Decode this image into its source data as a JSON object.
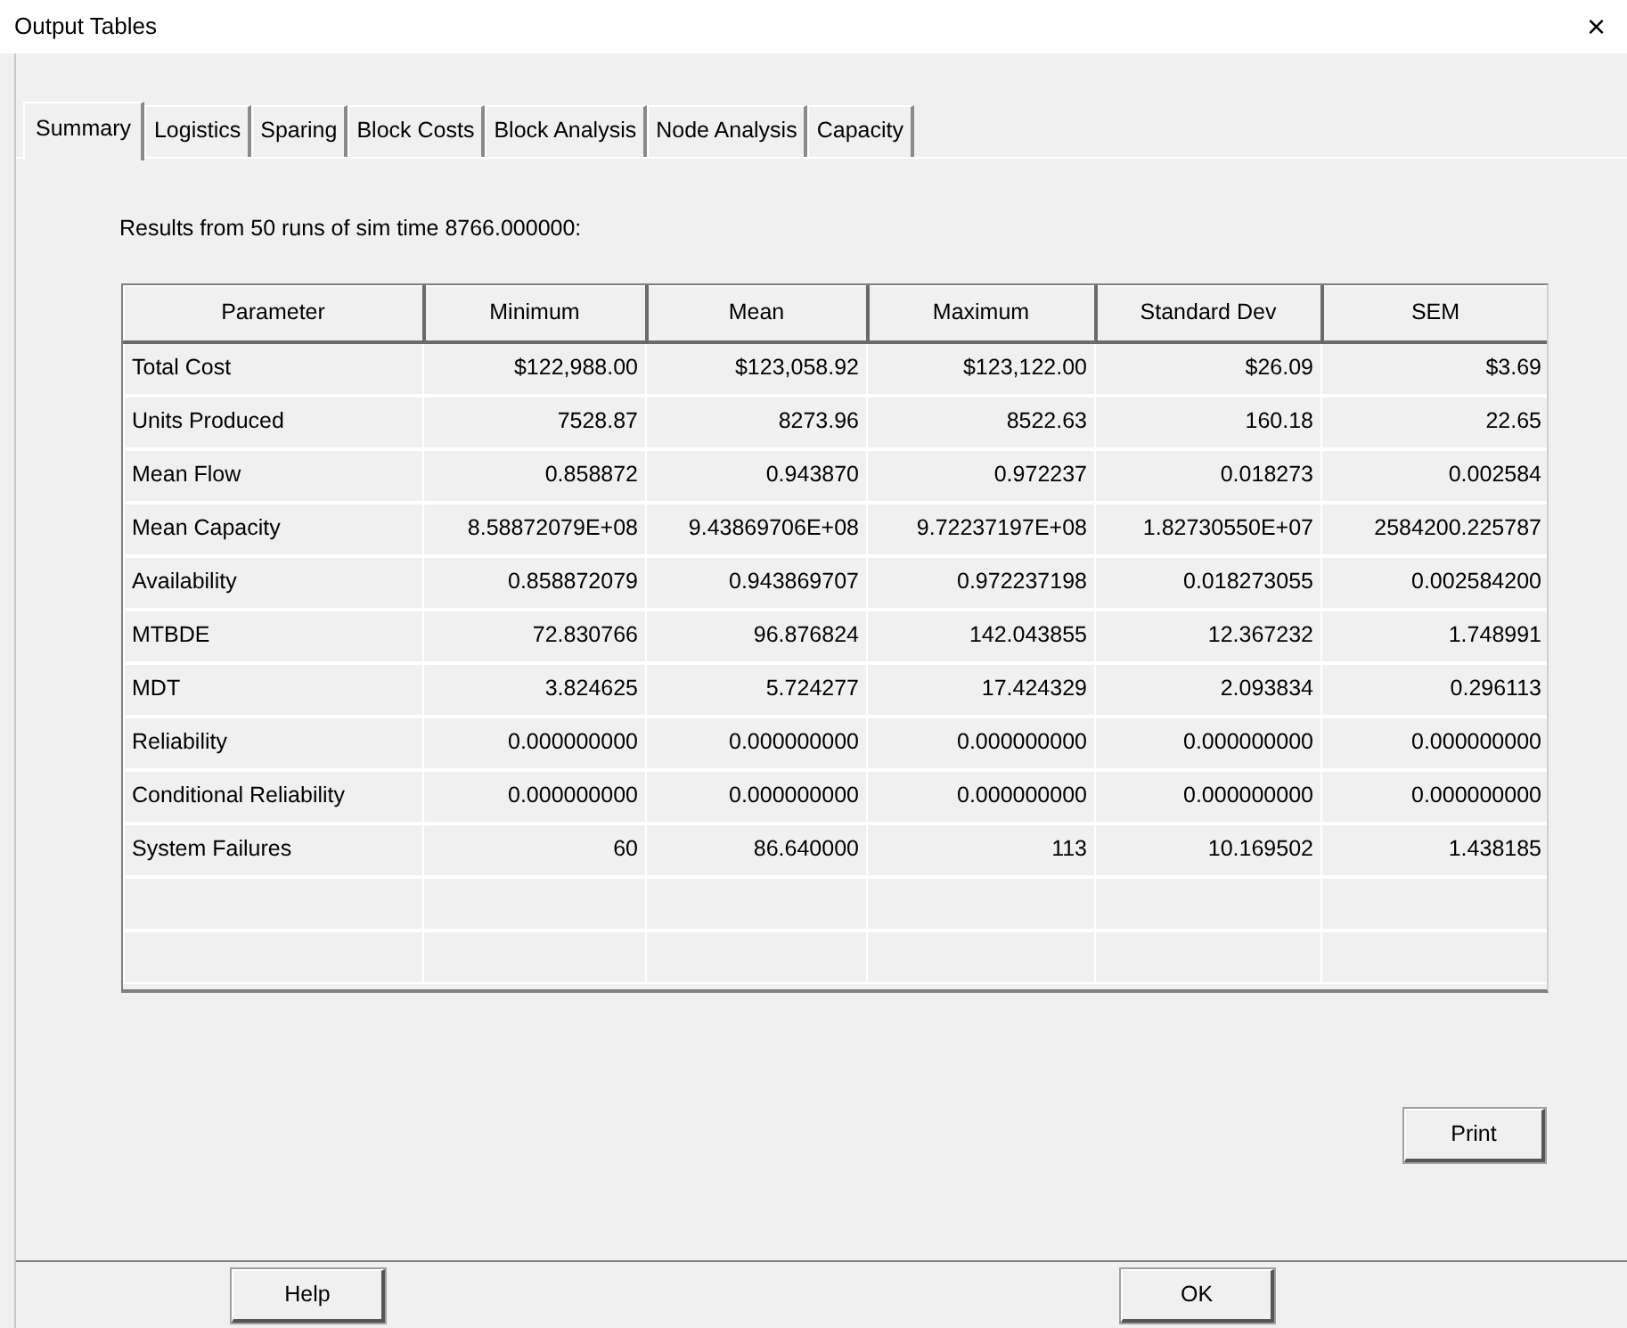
{
  "window": {
    "title": "Output Tables",
    "close": "×"
  },
  "tabs": [
    {
      "label": "Summary",
      "selected": true
    },
    {
      "label": "Logistics",
      "selected": false
    },
    {
      "label": "Sparing",
      "selected": false
    },
    {
      "label": "Block Costs",
      "selected": false
    },
    {
      "label": "Block Analysis",
      "selected": false
    },
    {
      "label": "Node Analysis",
      "selected": false
    },
    {
      "label": "Capacity",
      "selected": false
    }
  ],
  "caption": "Results from 50 runs of sim time 8766.000000:",
  "table": {
    "columns": [
      "Parameter",
      "Minimum",
      "Mean",
      "Maximum",
      "Standard Dev",
      "SEM"
    ],
    "rows": [
      [
        "Total Cost",
        "$122,988.00",
        "$123,058.92",
        "$123,122.00",
        "$26.09",
        "$3.69"
      ],
      [
        "Units Produced",
        "7528.87",
        "8273.96",
        "8522.63",
        "160.18",
        "22.65"
      ],
      [
        "Mean Flow",
        "0.858872",
        "0.943870",
        "0.972237",
        "0.018273",
        "0.002584"
      ],
      [
        "Mean Capacity",
        "8.58872079E+08",
        "9.43869706E+08",
        "9.72237197E+08",
        "1.82730550E+07",
        "2584200.225787"
      ],
      [
        "Availability",
        "0.858872079",
        "0.943869707",
        "0.972237198",
        "0.018273055",
        "0.002584200"
      ],
      [
        "MTBDE",
        "72.830766",
        "96.876824",
        "142.043855",
        "12.367232",
        "1.748991"
      ],
      [
        "MDT",
        "3.824625",
        "5.724277",
        "17.424329",
        "2.093834",
        "0.296113"
      ],
      [
        "Reliability",
        "0.000000000",
        "0.000000000",
        "0.000000000",
        "0.000000000",
        "0.000000000"
      ],
      [
        "Conditional Reliability",
        "0.000000000",
        "0.000000000",
        "0.000000000",
        "0.000000000",
        "0.000000000"
      ],
      [
        "System Failures",
        "60",
        "86.640000",
        "113",
        "10.169502",
        "1.438185"
      ]
    ]
  },
  "print_button": "Print",
  "buttons": [
    "Help",
    "OK"
  ]
}
